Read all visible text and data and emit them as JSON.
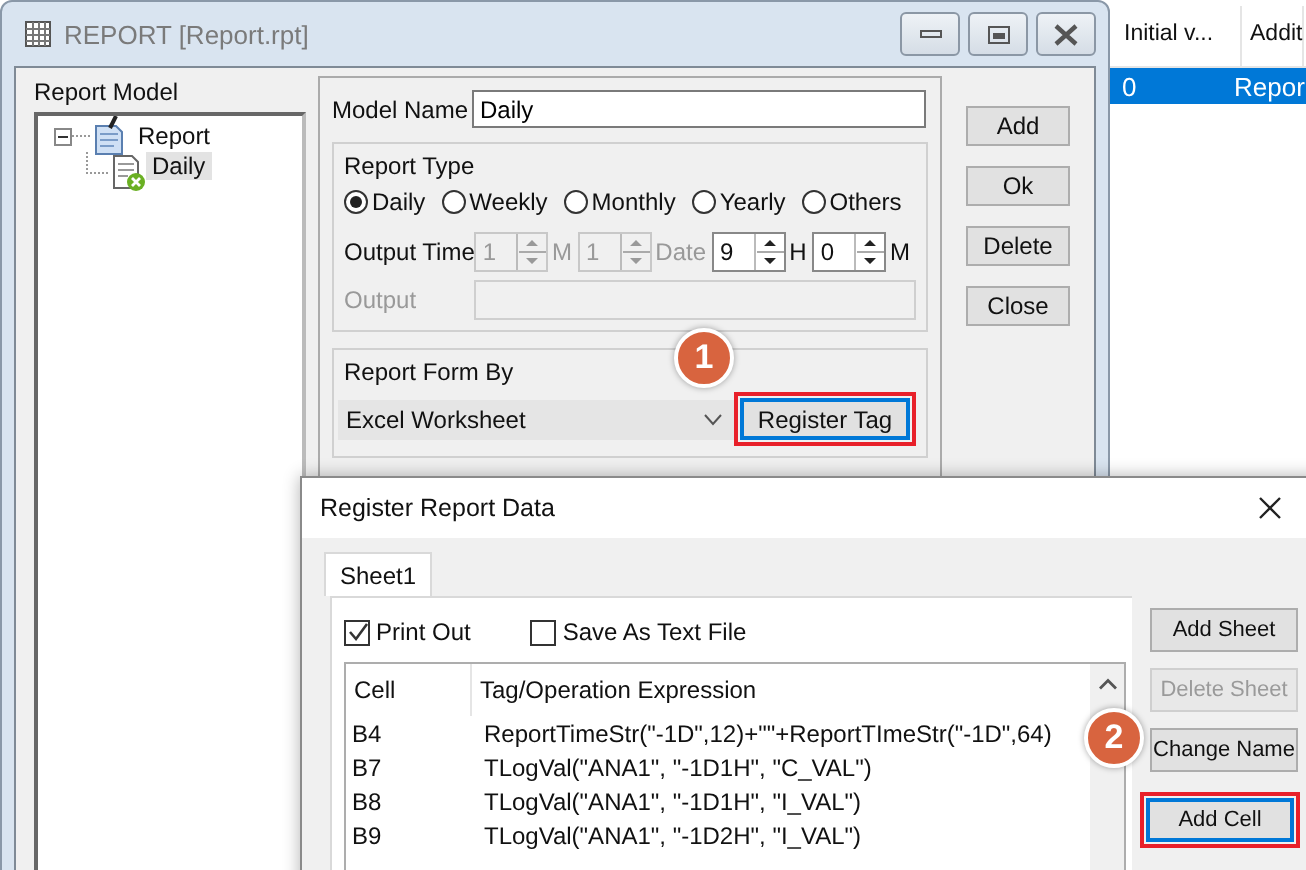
{
  "background_table": {
    "columns": [
      "Initial v...",
      "Addit"
    ],
    "rows": [
      {
        "cells": [
          "0",
          "Repor"
        ],
        "selected": true
      }
    ]
  },
  "main_window": {
    "title": "REPORT [Report.rpt]",
    "tree_label": "Report Model",
    "tree": [
      {
        "label": "Report",
        "expanded": true,
        "selected": false,
        "children": [
          {
            "label": "Daily",
            "selected": true
          }
        ]
      }
    ],
    "model_name": {
      "label": "Model Name",
      "value": "Daily"
    },
    "report_type": {
      "title": "Report Type",
      "options": [
        {
          "label": "Daily",
          "selected": true
        },
        {
          "label": "Weekly",
          "selected": false
        },
        {
          "label": "Monthly",
          "selected": false
        },
        {
          "label": "Yearly",
          "selected": false
        },
        {
          "label": "Others",
          "selected": false
        }
      ],
      "output_time": {
        "label": "Output Time",
        "fields": [
          {
            "value": "1",
            "unit": "M",
            "disabled": true
          },
          {
            "value": "1",
            "unit": "Date",
            "disabled": true
          },
          {
            "value": "9",
            "unit": "H",
            "disabled": false
          },
          {
            "value": "0",
            "unit": "M",
            "disabled": false
          }
        ]
      },
      "output": {
        "label": "Output",
        "disabled": true
      }
    },
    "report_form": {
      "title": "Report Form By",
      "value": "Excel Worksheet",
      "button": {
        "label": "Register Tag",
        "highlighted": true,
        "callout": "1"
      }
    },
    "buttons": [
      "Add",
      "Ok",
      "Delete",
      "Close"
    ]
  },
  "dialog": {
    "title": "Register Report Data",
    "tabs": [
      {
        "label": "Sheet1",
        "selected": true
      }
    ],
    "checkboxes": [
      {
        "label": "Print Out",
        "checked": true
      },
      {
        "label": "Save As Text File",
        "checked": false
      }
    ],
    "table": {
      "columns": [
        "Cell",
        "Tag/Operation Expression"
      ],
      "rows": [
        [
          "B4",
          "ReportTimeStr(\"-1D\",12)+\"\"+ReportTImeStr(\"-1D\",64)"
        ],
        [
          "B7",
          "TLogVal(\"ANA1\", \"-1D1H\", \"C_VAL\")"
        ],
        [
          "B8",
          "TLogVal(\"ANA1\", \"-1D1H\", \"I_VAL\")"
        ],
        [
          "B9",
          "TLogVal(\"ANA1\", \"-1D2H\", \"I_VAL\")"
        ]
      ]
    },
    "buttons": [
      {
        "label": "Add Sheet",
        "disabled": false,
        "highlighted": false
      },
      {
        "label": "Delete Sheet",
        "disabled": true,
        "highlighted": false
      },
      {
        "label": "Change Name",
        "disabled": false,
        "highlighted": false
      },
      {
        "label": "Add Cell",
        "disabled": false,
        "highlighted": true,
        "callout": "2"
      }
    ]
  }
}
